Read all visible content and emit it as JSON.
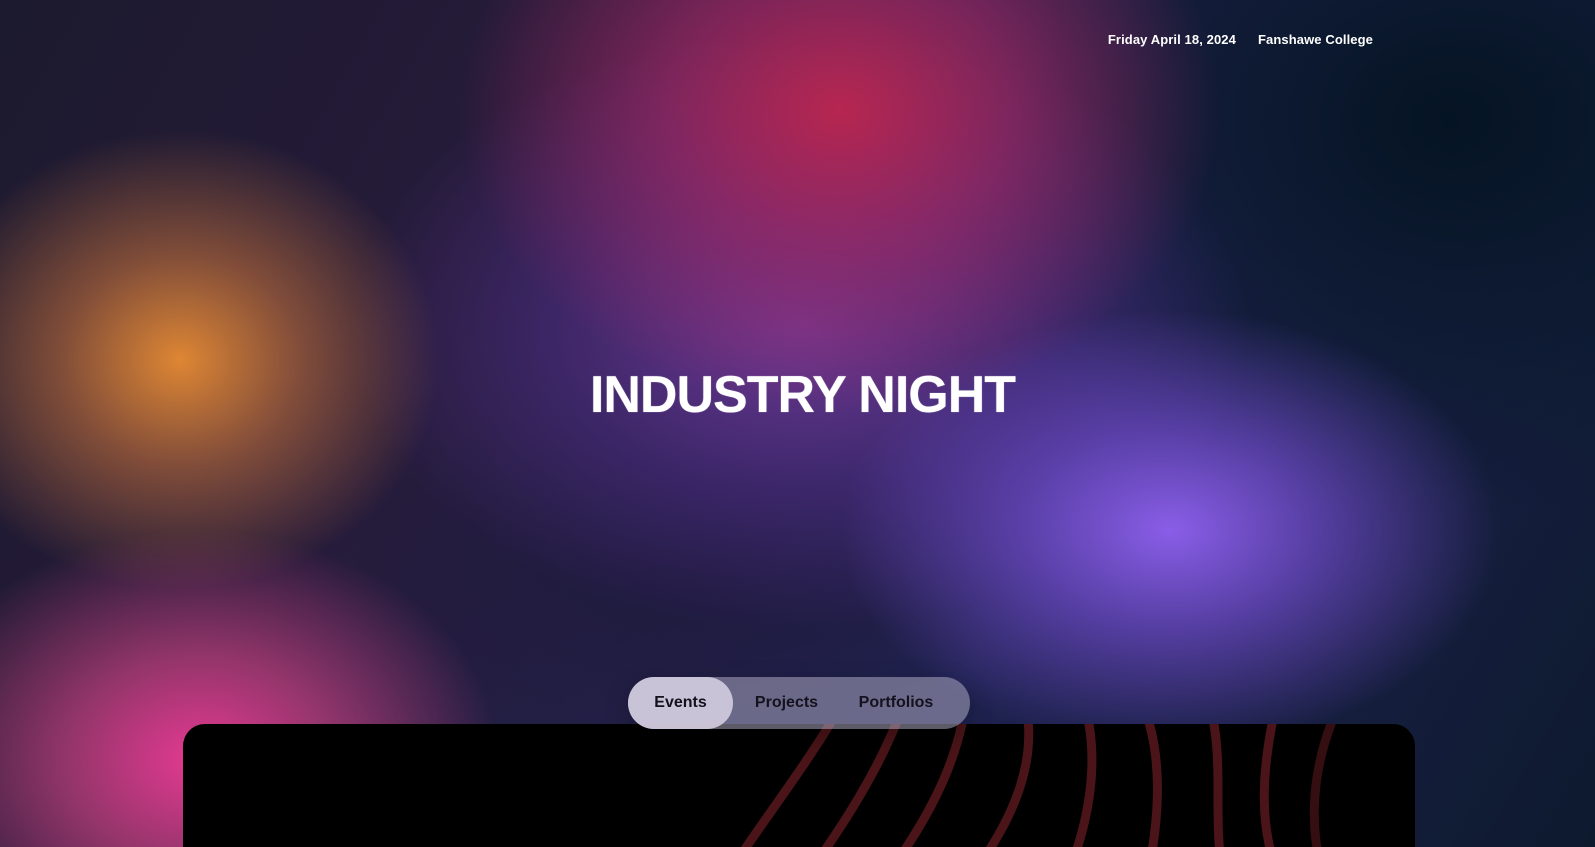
{
  "header": {
    "date": "Friday April 18, 2024",
    "location": "Fanshawe College"
  },
  "hero": {
    "title": "INDUSTRY NIGHT"
  },
  "tabs": [
    {
      "label": "Events",
      "active": true
    },
    {
      "label": "Projects",
      "active": false
    },
    {
      "label": "Portfolios",
      "active": false
    }
  ],
  "colors": {
    "accent_orange": "#e88c34",
    "accent_pink": "#f03c96",
    "accent_crimson": "#be2650",
    "accent_violet": "#8c5feb",
    "card_bg": "#000000",
    "card_stripes": "#4a1418",
    "tab_pill_bg": "#aaa5be",
    "tab_active_bg": "#cdc8da"
  }
}
